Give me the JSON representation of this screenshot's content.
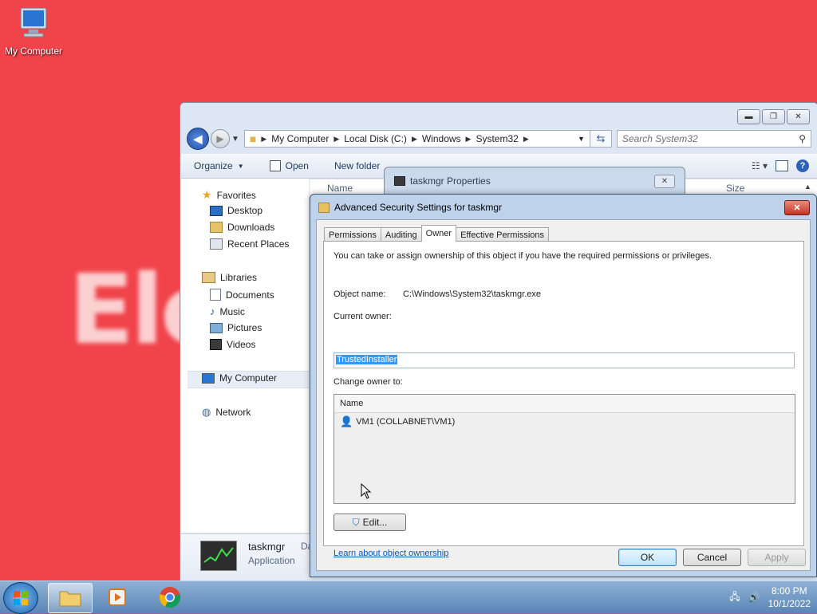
{
  "desktop": {
    "icon_label": "My Computer",
    "watermark": "Ele"
  },
  "explorer": {
    "breadcrumbs": [
      "My Computer",
      "Local Disk (C:)",
      "Windows",
      "System32"
    ],
    "search_placeholder": "Search System32",
    "toolbar": {
      "organize": "Organize",
      "open": "Open",
      "new_folder": "New folder"
    },
    "columns": {
      "name": "Name",
      "size": "Size"
    },
    "nav": {
      "favorites": "Favorites",
      "desktop": "Desktop",
      "downloads": "Downloads",
      "recent": "Recent Places",
      "libraries": "Libraries",
      "documents": "Documents",
      "music": "Music",
      "pictures": "Pictures",
      "videos": "Videos",
      "my_computer": "My Computer",
      "network": "Network"
    },
    "details": {
      "name": "taskmgr",
      "type": "Application",
      "date_trunc": "Da"
    }
  },
  "props_dialog": {
    "title": "taskmgr Properties"
  },
  "adv_dialog": {
    "title": "Advanced Security Settings for taskmgr",
    "tabs": [
      "Permissions",
      "Auditing",
      "Owner",
      "Effective Permissions"
    ],
    "active_tab": "Owner",
    "intro": "You can take or assign ownership of this object if you have the required permissions or privileges.",
    "object_name_label": "Object name:",
    "object_name_value": "C:\\Windows\\System32\\taskmgr.exe",
    "current_owner_label": "Current owner:",
    "current_owner_value": "TrustedInstaller",
    "change_owner_label": "Change owner to:",
    "list_header": "Name",
    "list_items": [
      "VM1 (COLLABNET\\VM1)"
    ],
    "edit_button": "Edit...",
    "learn_link": "Learn about object ownership",
    "ok": "OK",
    "cancel": "Cancel",
    "apply": "Apply"
  },
  "taskbar": {
    "time": "8:00 PM",
    "date": "10/1/2022"
  }
}
